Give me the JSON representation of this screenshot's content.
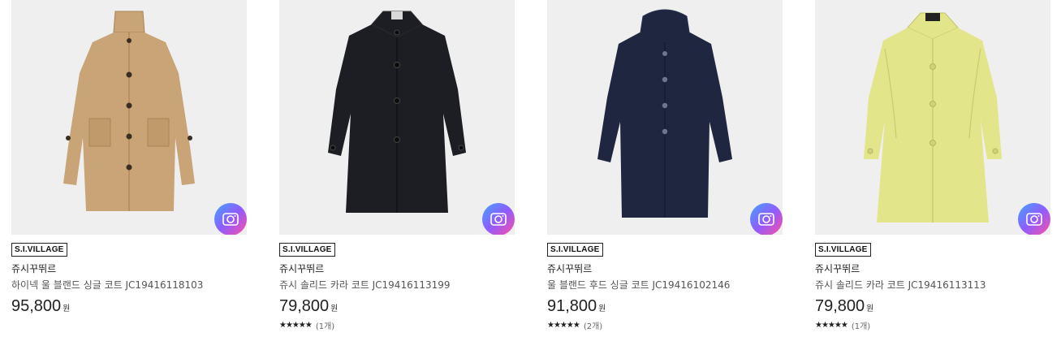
{
  "products": [
    {
      "badge": "S.I.VILLAGE",
      "brand": "쥬시꾸뛰르",
      "name": "하이넥 울 블랜드 싱글 코트 JC19416118103",
      "price": "95,800",
      "currency": "원",
      "coat_color": "#c9a477",
      "coat_shade": "#b38e62",
      "stars": "",
      "review_count": ""
    },
    {
      "badge": "S.I.VILLAGE",
      "brand": "쥬시꾸뛰르",
      "name": "쥬시 솔리드 카라 코트 JC19416113199",
      "price": "79,800",
      "currency": "원",
      "coat_color": "#1c1e23",
      "coat_shade": "#0f1013",
      "stars": "★★★★★",
      "review_count": "(1개)"
    },
    {
      "badge": "S.I.VILLAGE",
      "brand": "쥬시꾸뛰르",
      "name": "울 블랜드 후드 싱글 코트 JC19416102146",
      "price": "91,800",
      "currency": "원",
      "coat_color": "#1f2640",
      "coat_shade": "#151a2e",
      "stars": "★★★★★",
      "review_count": "(2개)"
    },
    {
      "badge": "S.I.VILLAGE",
      "brand": "쥬시꾸뛰르",
      "name": "쥬시 솔리드 카라 코트 JC19416113113",
      "price": "79,800",
      "currency": "원",
      "coat_color": "#e3e58a",
      "coat_shade": "#c8cb6e",
      "stars": "★★★★★",
      "review_count": "(1개)"
    }
  ],
  "icons": {
    "image_search": "camera-search-icon"
  }
}
